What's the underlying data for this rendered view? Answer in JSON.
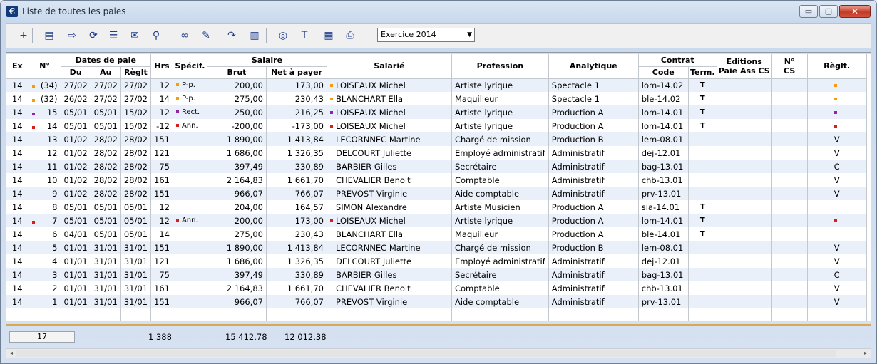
{
  "window": {
    "title": "Liste de toutes les paies",
    "app_icon": "€",
    "buttons": {
      "minimize": "▭",
      "maximize": "▢",
      "close": "✕"
    }
  },
  "toolbar": {
    "icons": [
      {
        "name": "add-icon",
        "glyph": "+"
      },
      {
        "name": "document-icon",
        "glyph": "▤"
      },
      {
        "name": "export-icon",
        "glyph": "⇨"
      },
      {
        "name": "refresh-icon",
        "glyph": "⟳"
      },
      {
        "name": "list-icon",
        "glyph": "☰"
      },
      {
        "name": "mail-merge-icon",
        "glyph": "✉"
      },
      {
        "name": "magnifier-icon",
        "glyph": "⚲"
      },
      {
        "name": "glasses-icon",
        "glyph": "∞"
      },
      {
        "name": "pencil-icon",
        "glyph": "✎"
      },
      {
        "name": "forward-icon",
        "glyph": "↷"
      },
      {
        "name": "report-icon",
        "glyph": "▥"
      },
      {
        "name": "coins-icon",
        "glyph": "◎"
      },
      {
        "name": "text-tool-icon",
        "glyph": "T"
      },
      {
        "name": "grid-icon",
        "glyph": "▦"
      },
      {
        "name": "printer-icon",
        "glyph": "⎙"
      }
    ],
    "exercise_select": "Exercice 2014",
    "exercise_arrow": "▼"
  },
  "headers": {
    "ex": "Ex",
    "num": "N°",
    "dates": "Dates de paie",
    "du": "Du",
    "au": "Au",
    "reglt": "Règlt",
    "hrs": "Hrs",
    "specif": "Spécif.",
    "salaire": "Salaire",
    "brut": "Brut",
    "net": "Net à payer",
    "salarie": "Salarié",
    "profession": "Profession",
    "analytique": "Analytique",
    "contrat": "Contrat",
    "code": "Code",
    "term": "Term.",
    "editions_1": "Editions",
    "editions_2": "Paie Ass CS",
    "ncs_1": "N°",
    "ncs_2": "CS",
    "reglt2": "Règlt."
  },
  "colors": {
    "orange": "#f39c12",
    "purple": "#8e24aa",
    "red": "#d0201a"
  },
  "rows": [
    {
      "ex": "14",
      "num": "(34)",
      "mark": "orange",
      "du": "27/02",
      "au": "27/02",
      "reglt": "27/02",
      "hrs": "12",
      "spec_mark": "orange",
      "spec": "P-p.",
      "brut": "200,00",
      "net": "173,00",
      "sal_mark": "orange",
      "salarie": "LOISEAUX Michel",
      "profession": "Artiste lyrique",
      "analytique": "Spectacle 1",
      "code": "lom-14.02",
      "term": "T",
      "edit": "",
      "ncs": "",
      "reg_mark": "orange",
      "reg": ""
    },
    {
      "ex": "14",
      "num": "(32)",
      "mark": "orange",
      "du": "26/02",
      "au": "27/02",
      "reglt": "27/02",
      "hrs": "14",
      "spec_mark": "orange",
      "spec": "P-p.",
      "brut": "275,00",
      "net": "230,43",
      "sal_mark": "orange",
      "salarie": "BLANCHART Ella",
      "profession": "Maquilleur",
      "analytique": "Spectacle 1",
      "code": "ble-14.02",
      "term": "T",
      "edit": "",
      "ncs": "",
      "reg_mark": "orange",
      "reg": ""
    },
    {
      "ex": "14",
      "num": "15",
      "mark": "purple",
      "du": "05/01",
      "au": "05/01",
      "reglt": "15/02",
      "hrs": "12",
      "spec_mark": "purple",
      "spec": "Rect.",
      "brut": "250,00",
      "net": "216,25",
      "sal_mark": "purple",
      "salarie": "LOISEAUX Michel",
      "profession": "Artiste lyrique",
      "analytique": "Production A",
      "code": "lom-14.01",
      "term": "T",
      "edit": "",
      "ncs": "",
      "reg_mark": "purple",
      "reg": ""
    },
    {
      "ex": "14",
      "num": "14",
      "mark": "red",
      "du": "05/01",
      "au": "05/01",
      "reglt": "15/02",
      "hrs": "-12",
      "spec_mark": "red",
      "spec": "Ann.",
      "brut": "-200,00",
      "net": "-173,00",
      "sal_mark": "red",
      "salarie": "LOISEAUX Michel",
      "profession": "Artiste lyrique",
      "analytique": "Production A",
      "code": "lom-14.01",
      "term": "T",
      "edit": "",
      "ncs": "",
      "reg_mark": "red",
      "reg": ""
    },
    {
      "ex": "14",
      "num": "13",
      "mark": "",
      "du": "01/02",
      "au": "28/02",
      "reglt": "28/02",
      "hrs": "151",
      "spec_mark": "",
      "spec": "",
      "brut": "1 890,00",
      "net": "1 413,84",
      "sal_mark": "",
      "salarie": "LECORNNEC Martine",
      "profession": "Chargé de mission",
      "analytique": "Production B",
      "code": "lem-08.01",
      "term": "",
      "edit": "",
      "ncs": "",
      "reg_mark": "",
      "reg": "V"
    },
    {
      "ex": "14",
      "num": "12",
      "mark": "",
      "du": "01/02",
      "au": "28/02",
      "reglt": "28/02",
      "hrs": "121",
      "spec_mark": "",
      "spec": "",
      "brut": "1 686,00",
      "net": "1 326,35",
      "sal_mark": "",
      "salarie": "DELCOURT Juliette",
      "profession": "Employé administratif",
      "analytique": "Administratif",
      "code": "dej-12.01",
      "term": "",
      "edit": "",
      "ncs": "",
      "reg_mark": "",
      "reg": "V"
    },
    {
      "ex": "14",
      "num": "11",
      "mark": "",
      "du": "01/02",
      "au": "28/02",
      "reglt": "28/02",
      "hrs": "75",
      "spec_mark": "",
      "spec": "",
      "brut": "397,49",
      "net": "330,89",
      "sal_mark": "",
      "salarie": "BARBIER Gilles",
      "profession": "Secrétaire",
      "analytique": "Administratif",
      "code": "bag-13.01",
      "term": "",
      "edit": "",
      "ncs": "",
      "reg_mark": "",
      "reg": "C"
    },
    {
      "ex": "14",
      "num": "10",
      "mark": "",
      "du": "01/02",
      "au": "28/02",
      "reglt": "28/02",
      "hrs": "161",
      "spec_mark": "",
      "spec": "",
      "brut": "2 164,83",
      "net": "1 661,70",
      "sal_mark": "",
      "salarie": "CHEVALIER Benoit",
      "profession": "Comptable",
      "analytique": "Administratif",
      "code": "chb-13.01",
      "term": "",
      "edit": "",
      "ncs": "",
      "reg_mark": "",
      "reg": "V"
    },
    {
      "ex": "14",
      "num": "9",
      "mark": "",
      "du": "01/02",
      "au": "28/02",
      "reglt": "28/02",
      "hrs": "151",
      "spec_mark": "",
      "spec": "",
      "brut": "966,07",
      "net": "766,07",
      "sal_mark": "",
      "salarie": "PREVOST Virginie",
      "profession": "Aide comptable",
      "analytique": "Administratif",
      "code": "prv-13.01",
      "term": "",
      "edit": "",
      "ncs": "",
      "reg_mark": "",
      "reg": "V"
    },
    {
      "ex": "14",
      "num": "8",
      "mark": "",
      "du": "05/01",
      "au": "05/01",
      "reglt": "05/01",
      "hrs": "12",
      "spec_mark": "",
      "spec": "",
      "brut": "204,00",
      "net": "164,57",
      "sal_mark": "",
      "salarie": "SIMON Alexandre",
      "profession": "Artiste Musicien",
      "analytique": "Production A",
      "code": "sia-14.01",
      "term": "T",
      "edit": "",
      "ncs": "",
      "reg_mark": "",
      "reg": ""
    },
    {
      "ex": "14",
      "num": "7",
      "mark": "red",
      "du": "05/01",
      "au": "05/01",
      "reglt": "05/01",
      "hrs": "12",
      "spec_mark": "red",
      "spec": "Ann.",
      "brut": "200,00",
      "net": "173,00",
      "sal_mark": "red",
      "salarie": "LOISEAUX Michel",
      "profession": "Artiste lyrique",
      "analytique": "Production A",
      "code": "lom-14.01",
      "term": "T",
      "edit": "",
      "ncs": "",
      "reg_mark": "red",
      "reg": ""
    },
    {
      "ex": "14",
      "num": "6",
      "mark": "",
      "du": "04/01",
      "au": "05/01",
      "reglt": "05/01",
      "hrs": "14",
      "spec_mark": "",
      "spec": "",
      "brut": "275,00",
      "net": "230,43",
      "sal_mark": "",
      "salarie": "BLANCHART Ella",
      "profession": "Maquilleur",
      "analytique": "Production A",
      "code": "ble-14.01",
      "term": "T",
      "edit": "",
      "ncs": "",
      "reg_mark": "",
      "reg": ""
    },
    {
      "ex": "14",
      "num": "5",
      "mark": "",
      "du": "01/01",
      "au": "31/01",
      "reglt": "31/01",
      "hrs": "151",
      "spec_mark": "",
      "spec": "",
      "brut": "1 890,00",
      "net": "1 413,84",
      "sal_mark": "",
      "salarie": "LECORNNEC Martine",
      "profession": "Chargé de mission",
      "analytique": "Production B",
      "code": "lem-08.01",
      "term": "",
      "edit": "",
      "ncs": "",
      "reg_mark": "",
      "reg": "V"
    },
    {
      "ex": "14",
      "num": "4",
      "mark": "",
      "du": "01/01",
      "au": "31/01",
      "reglt": "31/01",
      "hrs": "121",
      "spec_mark": "",
      "spec": "",
      "brut": "1 686,00",
      "net": "1 326,35",
      "sal_mark": "",
      "salarie": "DELCOURT Juliette",
      "profession": "Employé administratif",
      "analytique": "Administratif",
      "code": "dej-12.01",
      "term": "",
      "edit": "",
      "ncs": "",
      "reg_mark": "",
      "reg": "V"
    },
    {
      "ex": "14",
      "num": "3",
      "mark": "",
      "du": "01/01",
      "au": "31/01",
      "reglt": "31/01",
      "hrs": "75",
      "spec_mark": "",
      "spec": "",
      "brut": "397,49",
      "net": "330,89",
      "sal_mark": "",
      "salarie": "BARBIER Gilles",
      "profession": "Secrétaire",
      "analytique": "Administratif",
      "code": "bag-13.01",
      "term": "",
      "edit": "",
      "ncs": "",
      "reg_mark": "",
      "reg": "C"
    },
    {
      "ex": "14",
      "num": "2",
      "mark": "",
      "du": "01/01",
      "au": "31/01",
      "reglt": "31/01",
      "hrs": "161",
      "spec_mark": "",
      "spec": "",
      "brut": "2 164,83",
      "net": "1 661,70",
      "sal_mark": "",
      "salarie": "CHEVALIER Benoit",
      "profession": "Comptable",
      "analytique": "Administratif",
      "code": "chb-13.01",
      "term": "",
      "edit": "",
      "ncs": "",
      "reg_mark": "",
      "reg": "V"
    },
    {
      "ex": "14",
      "num": "1",
      "mark": "",
      "du": "01/01",
      "au": "31/01",
      "reglt": "31/01",
      "hrs": "151",
      "spec_mark": "",
      "spec": "",
      "brut": "966,07",
      "net": "766,07",
      "sal_mark": "",
      "salarie": "PREVOST Virginie",
      "profession": "Aide comptable",
      "analytique": "Administratif",
      "code": "prv-13.01",
      "term": "",
      "edit": "",
      "ncs": "",
      "reg_mark": "",
      "reg": "V"
    }
  ],
  "totals": {
    "count": "17",
    "hrs": "1 388",
    "brut": "15 412,78",
    "net": "12 012,38"
  },
  "scrollbar": {
    "left": "◂",
    "right": "▸"
  }
}
